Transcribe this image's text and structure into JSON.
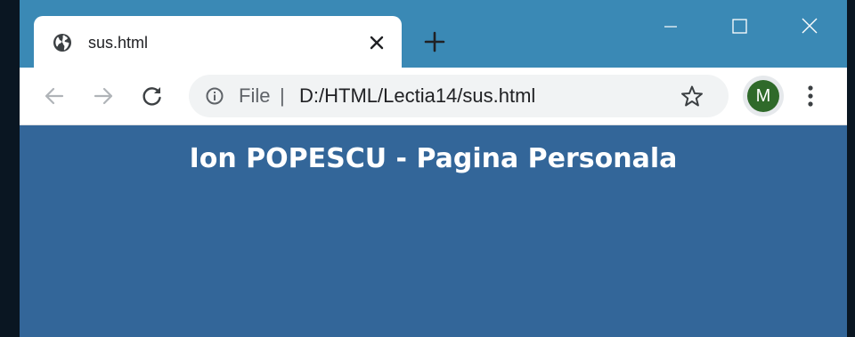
{
  "tab": {
    "title": "sus.html",
    "favicon": "globe-icon"
  },
  "toolbar": {
    "back_icon": "arrow-left-icon",
    "forward_icon": "arrow-right-icon",
    "reload_icon": "reload-icon",
    "omnibox": {
      "info_icon": "info-icon",
      "scheme": "File",
      "separator": "|",
      "url": "D:/HTML/Lectia14/sus.html",
      "star_icon": "star-icon"
    },
    "profile_initial": "M",
    "menu_icon": "kebab-menu-icon"
  },
  "window_controls": [
    "minimize-icon",
    "maximize-icon",
    "close-icon"
  ],
  "page": {
    "heading": "Ion POPESCU - Pagina Personala"
  },
  "colors": {
    "frame": "#3a89b5",
    "page_background": "#336699",
    "heading_text": "#ffffff",
    "avatar": "#2f6a2a"
  }
}
